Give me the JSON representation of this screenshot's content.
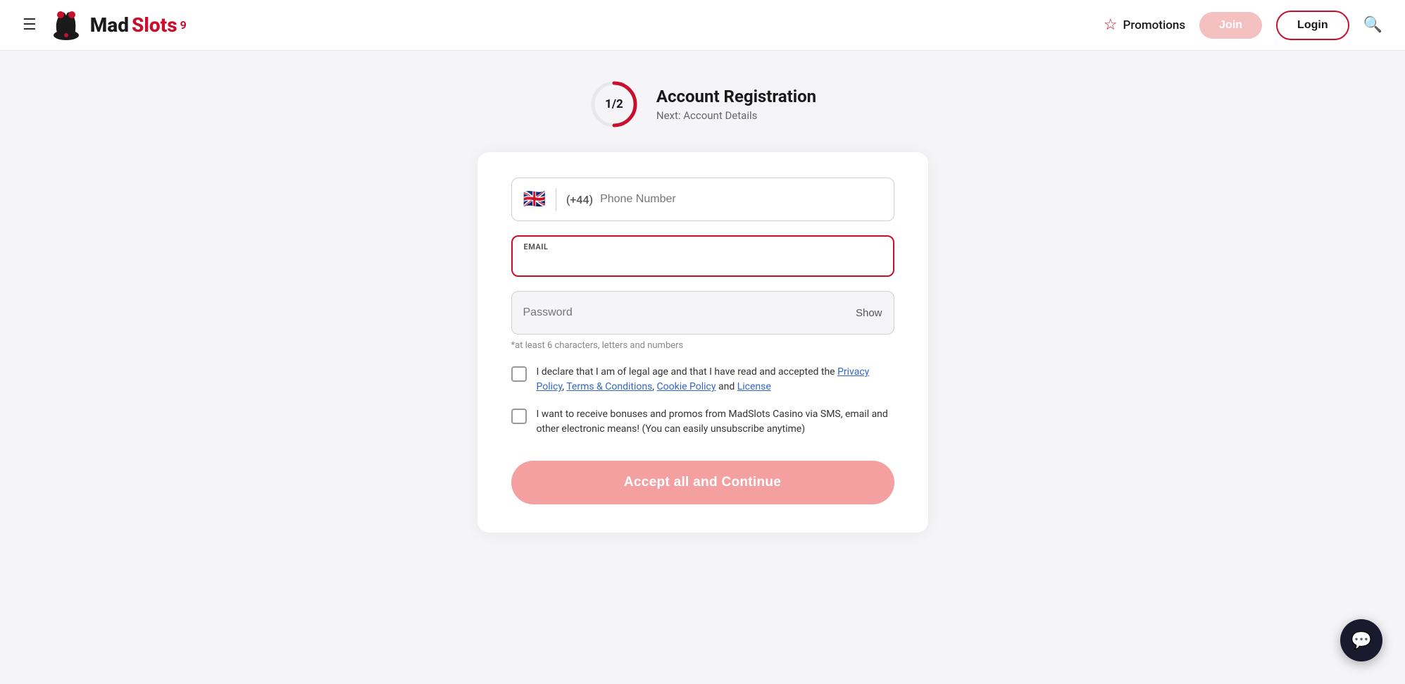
{
  "header": {
    "hamburger_label": "☰",
    "logo_text_black": "Mad",
    "logo_text_red": "Slots",
    "logo_superscript": "9",
    "promotions_label": "Promotions",
    "join_label": "Join",
    "login_label": "Login"
  },
  "registration": {
    "step": "1/2",
    "title": "Account Registration",
    "next_label": "Next: Account Details"
  },
  "form": {
    "phone": {
      "flag": "🇬🇧",
      "code": "(+44)",
      "placeholder": "Phone Number"
    },
    "email": {
      "label": "EMAIL",
      "placeholder": "",
      "value": ""
    },
    "password": {
      "placeholder": "Password",
      "show_label": "Show",
      "hint": "*at least 6 characters, letters and numbers"
    },
    "checkbox1": {
      "text_before": "I declare that I am of legal age and that I have read and accepted the ",
      "links": [
        {
          "label": "Privacy Policy",
          "url": "#"
        },
        {
          "label": "Terms & Conditions",
          "url": "#"
        },
        {
          "label": "Cookie Policy",
          "url": "#"
        },
        {
          "label": "License",
          "url": "#"
        }
      ],
      "text_and": " and "
    },
    "checkbox2": {
      "text": "I want to receive bonuses and promos from MadSlots Casino via SMS, email and other electronic means! (You can easily unsubscribe anytime)"
    },
    "submit_label": "Accept all and Continue"
  }
}
